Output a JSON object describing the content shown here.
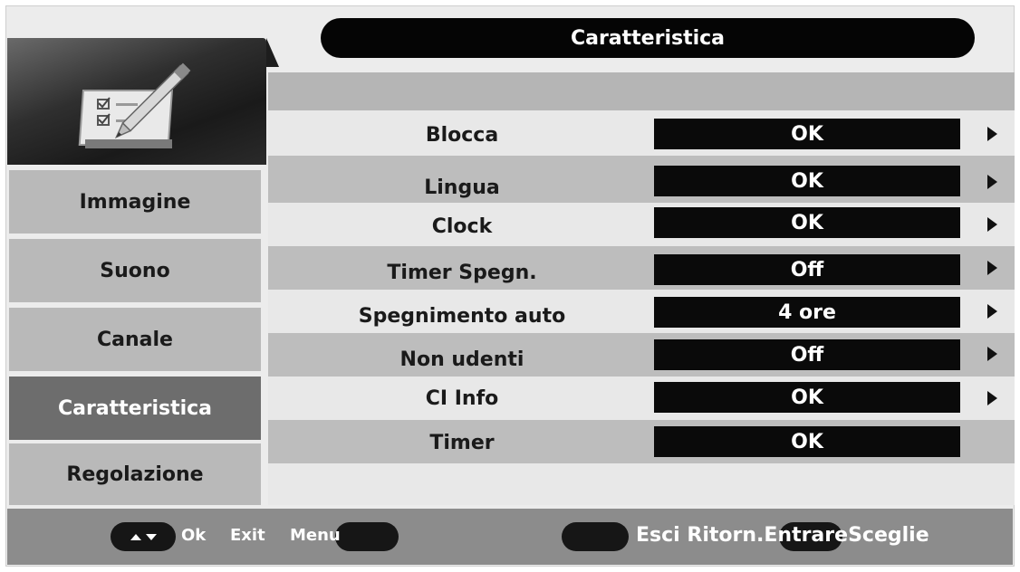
{
  "header": {
    "title": "Caratteristica"
  },
  "sidebar": {
    "items": [
      {
        "label": "Immagine"
      },
      {
        "label": "Suono"
      },
      {
        "label": "Canale"
      },
      {
        "label": "Caratteristica"
      },
      {
        "label": "Regolazione"
      }
    ],
    "active_index": 3
  },
  "settings": [
    {
      "label": "Blocca",
      "value": "OK"
    },
    {
      "label": "Lingua",
      "value": "OK"
    },
    {
      "label": "Clock",
      "value": "OK"
    },
    {
      "label": "Timer Spegn.",
      "value": "Off"
    },
    {
      "label": "Spegnimento auto",
      "value": "4 ore"
    },
    {
      "label": "Non udenti",
      "value": "Off"
    },
    {
      "label": "CI Info",
      "value": "OK"
    },
    {
      "label": "Timer",
      "value": "OK"
    }
  ],
  "footer": {
    "ok": "Ok",
    "exit": "Exit",
    "menu": "Menu",
    "esci": "Esci",
    "ritorn": "Ritorn.",
    "entrare": "Entrare",
    "sceglie": "Sceglie"
  },
  "colors": {
    "background": "#ececec",
    "active_item": "#6d6d6d",
    "value_box": "#0a0a0a"
  }
}
